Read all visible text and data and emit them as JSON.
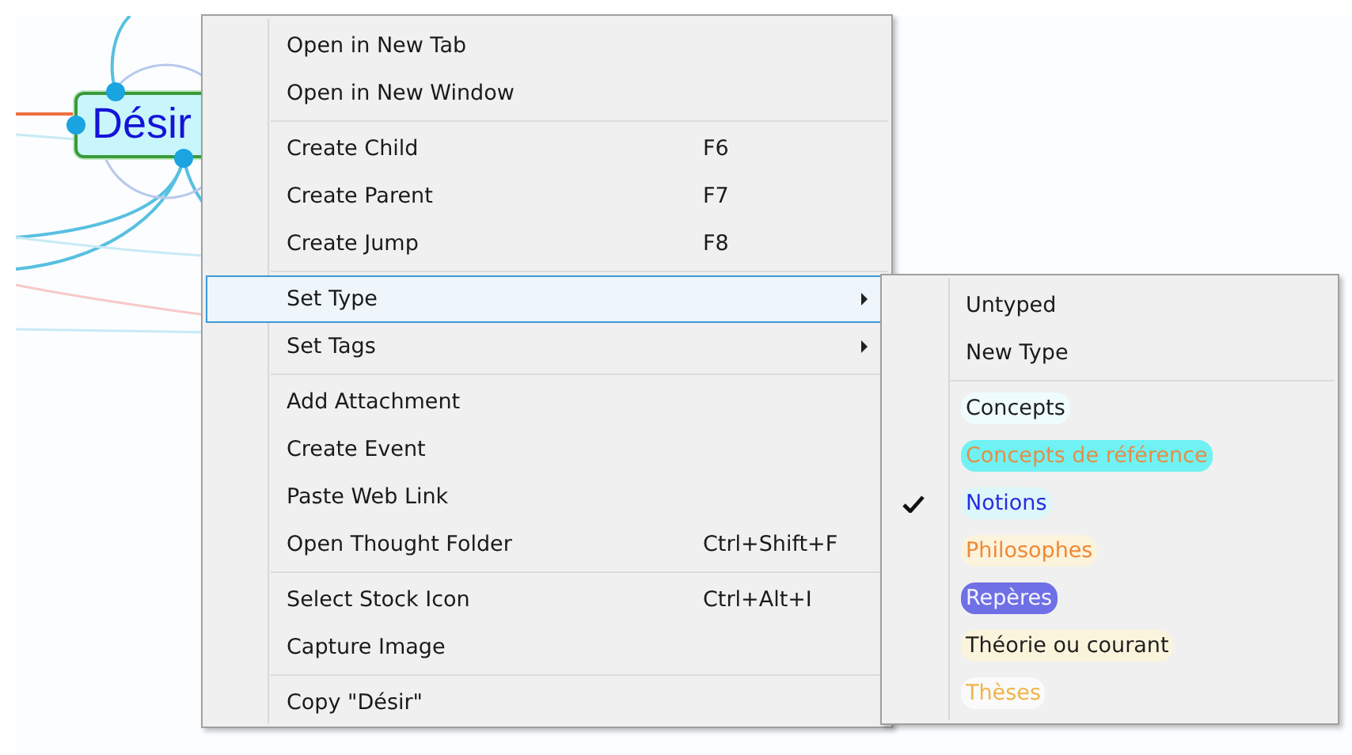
{
  "map_node": {
    "label": "Désir",
    "selected": true
  },
  "context_menu": {
    "groups": [
      [
        {
          "label": "Open in New Tab",
          "highlighted": false,
          "has_submenu": false
        },
        {
          "label": "Open in New Window",
          "highlighted": false,
          "has_submenu": false
        }
      ],
      [
        {
          "label": "Create Child",
          "shortcut": "F6",
          "highlighted": false,
          "has_submenu": false
        },
        {
          "label": "Create Parent",
          "shortcut": "F7",
          "highlighted": false,
          "has_submenu": false
        },
        {
          "label": "Create Jump",
          "shortcut": "F8",
          "highlighted": false,
          "has_submenu": false
        }
      ],
      [
        {
          "label": "Set Type",
          "highlighted": true,
          "has_submenu": true
        },
        {
          "label": "Set Tags",
          "highlighted": false,
          "has_submenu": true
        }
      ],
      [
        {
          "label": "Add Attachment",
          "highlighted": false,
          "has_submenu": false
        },
        {
          "label": "Create Event",
          "highlighted": false,
          "has_submenu": false
        },
        {
          "label": "Paste Web Link",
          "highlighted": false,
          "has_submenu": false
        },
        {
          "label": "Open Thought Folder",
          "shortcut": "Ctrl+Shift+F",
          "highlighted": false,
          "has_submenu": false
        }
      ],
      [
        {
          "label": "Select Stock Icon",
          "shortcut": "Ctrl+Alt+I",
          "highlighted": false,
          "has_submenu": false
        },
        {
          "label": "Capture Image",
          "highlighted": false,
          "has_submenu": false
        }
      ],
      [
        {
          "label": "Copy \"Désir\"",
          "highlighted": false,
          "has_submenu": false
        }
      ]
    ]
  },
  "type_submenu": {
    "groups": [
      [
        {
          "label": "Untyped",
          "checked": false
        },
        {
          "label": "New Type",
          "checked": false
        }
      ],
      [
        {
          "label": "Concepts",
          "checked": false,
          "color": "#eefcfd",
          "text": {
            "color": "#1f1f1f"
          }
        },
        {
          "label": "Concepts de référence",
          "checked": false,
          "color": "#70f2f4",
          "text": {
            "color": "#e0904a"
          }
        },
        {
          "label": "Notions",
          "checked": true,
          "color": "#dcf7fa",
          "text": {
            "color": "#2a2ae0"
          }
        },
        {
          "label": "Philosophes",
          "checked": false,
          "color": "#fcf3dc",
          "text": {
            "color": "#f08838"
          }
        },
        {
          "label": "Repères",
          "checked": false,
          "color": "#6f6fe6",
          "text": {
            "color": "#f4f4ff"
          }
        },
        {
          "label": "Théorie ou courant",
          "checked": false,
          "color": "#fbf4dc",
          "text": {
            "color": "#1f1f1f"
          }
        },
        {
          "label": "Thèses",
          "checked": false,
          "color": "#fafafa",
          "text": {
            "color": "#f0b44a"
          }
        }
      ]
    ]
  }
}
